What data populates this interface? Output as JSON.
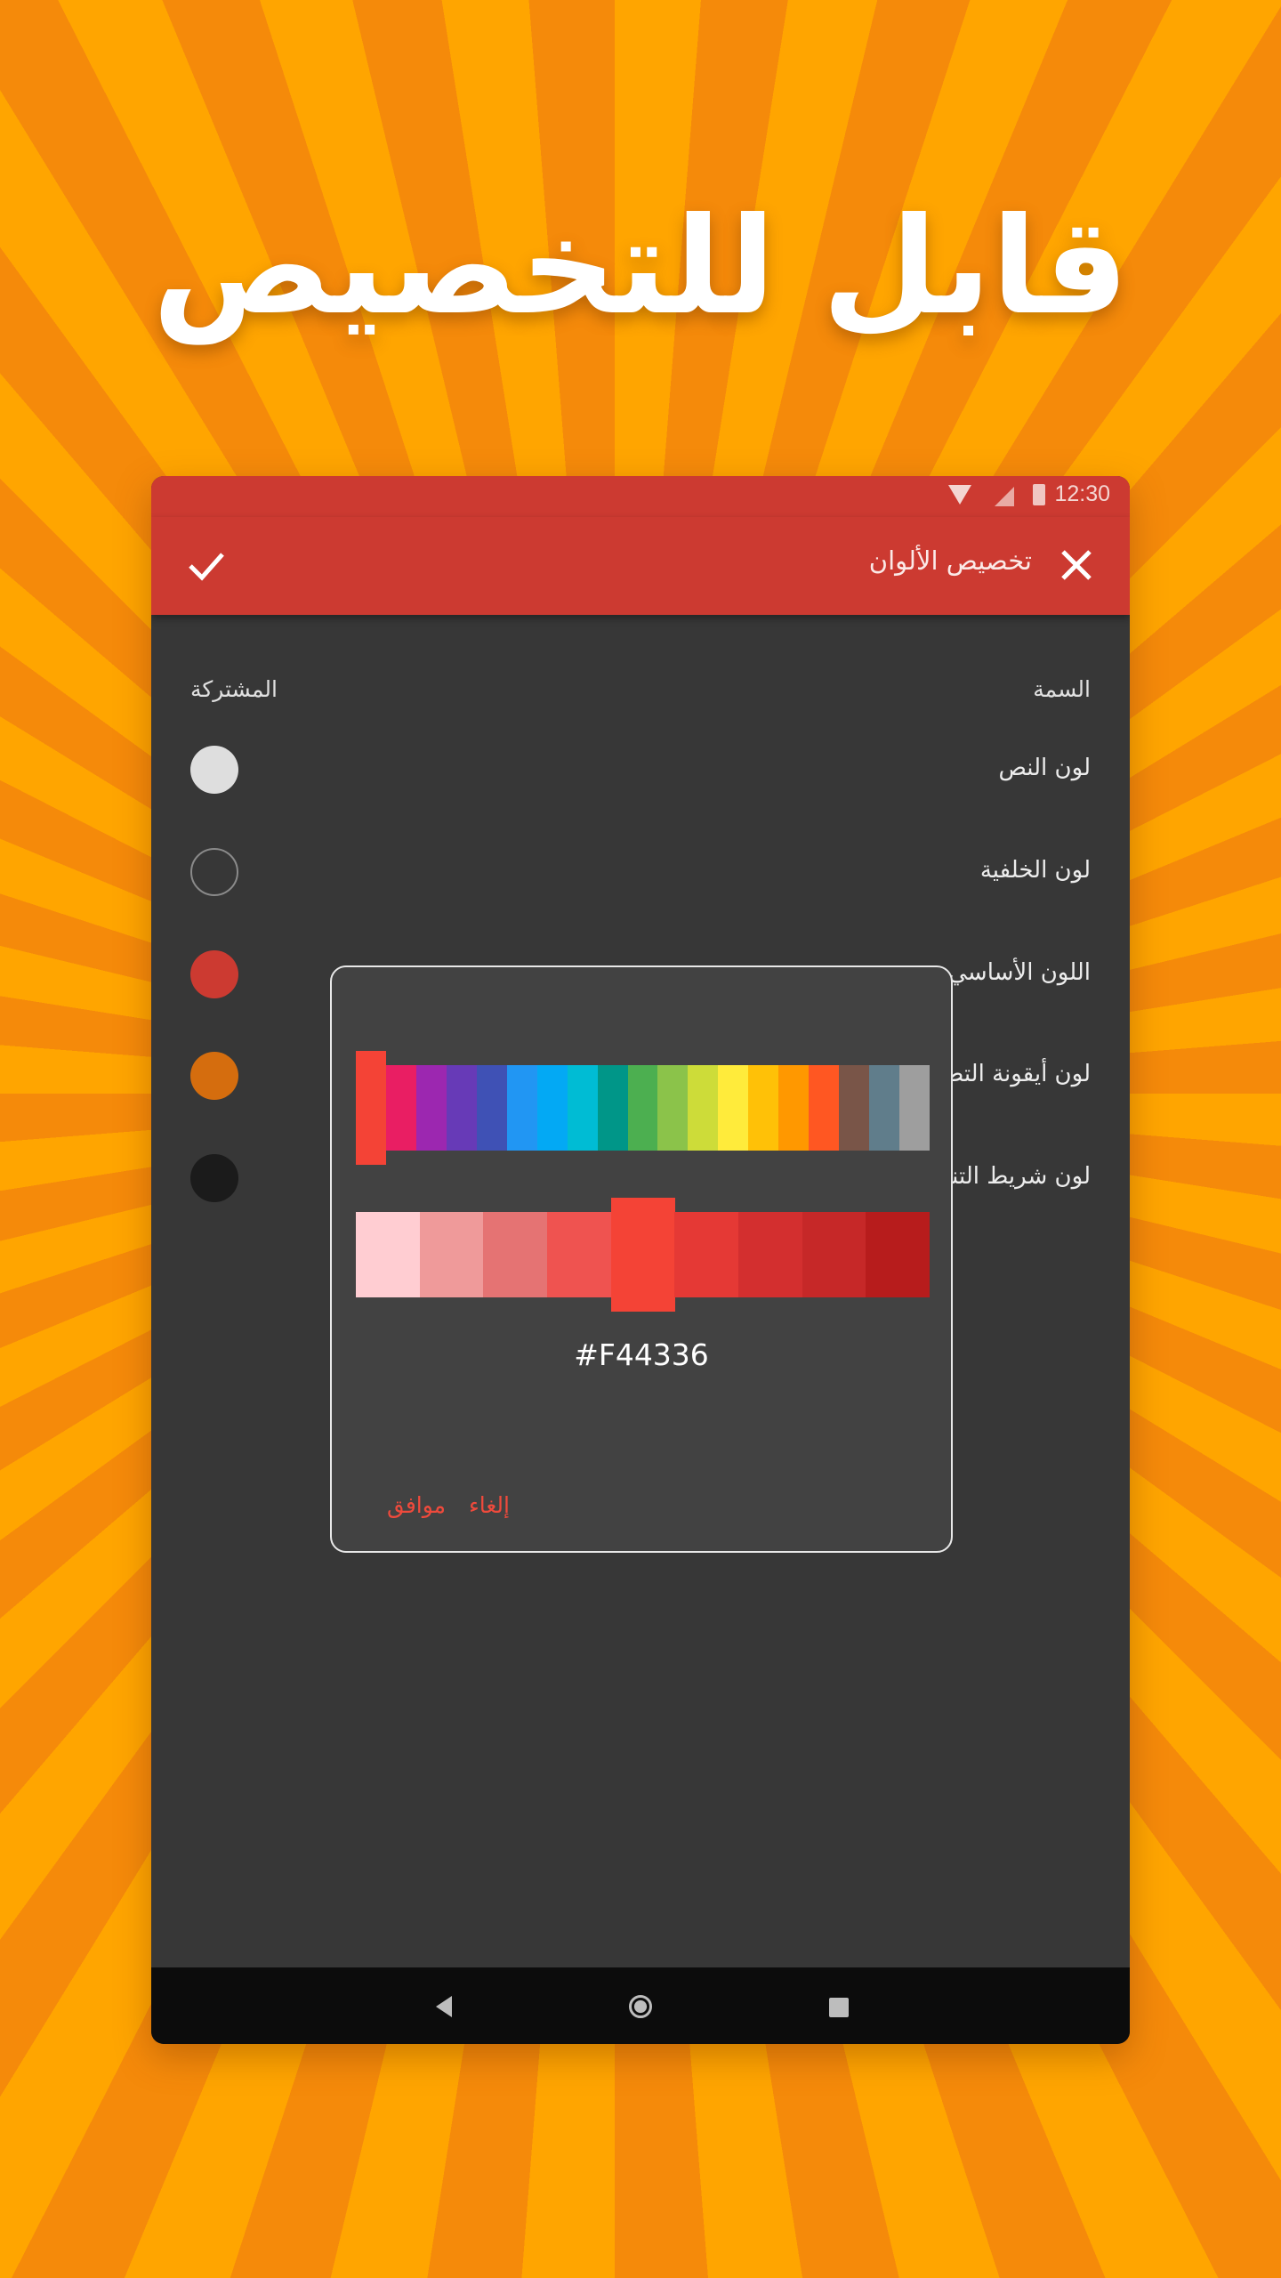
{
  "promo": {
    "headline": "قابل للتخصيص"
  },
  "statusbar": {
    "time": "12:30"
  },
  "appbar": {
    "title": "تخصيص الألوان"
  },
  "sections": {
    "left": "المشتركة",
    "right": "السمة"
  },
  "preferences": [
    {
      "label": "لون النص",
      "color": "#dedede",
      "ring": false
    },
    {
      "label": "لون الخلفية",
      "color": "#373737",
      "ring": true
    },
    {
      "label": "اللون الأساسي",
      "color": "#cc3a31",
      "ring": false
    },
    {
      "label": "لون أيقونة التطبيق",
      "color": "#d56d0e",
      "ring": false
    },
    {
      "label": "لون شريط التنقل",
      "color": "#1b1b1b",
      "ring": false
    }
  ],
  "dialog": {
    "hue_colors": [
      "#F44336",
      "#E91E63",
      "#9C27B0",
      "#673AB7",
      "#3F51B5",
      "#2196F3",
      "#03A9F4",
      "#00BCD4",
      "#009688",
      "#4CAF50",
      "#8BC34A",
      "#CDDC39",
      "#FFEB3B",
      "#FFC107",
      "#FF9800",
      "#FF5722",
      "#795548",
      "#607D8B",
      "#9E9E9E"
    ],
    "selected_hue": 0,
    "shade_colors": [
      "#FFCDD2",
      "#EF9A9A",
      "#E57373",
      "#EF5350",
      "#F44336",
      "#E53935",
      "#D32F2F",
      "#C62828",
      "#B71C1C"
    ],
    "selected_shade": 4,
    "hex": "#F44336",
    "ok_label": "موافق",
    "cancel_label": "إلغاء"
  },
  "accent": "#cc3a31"
}
